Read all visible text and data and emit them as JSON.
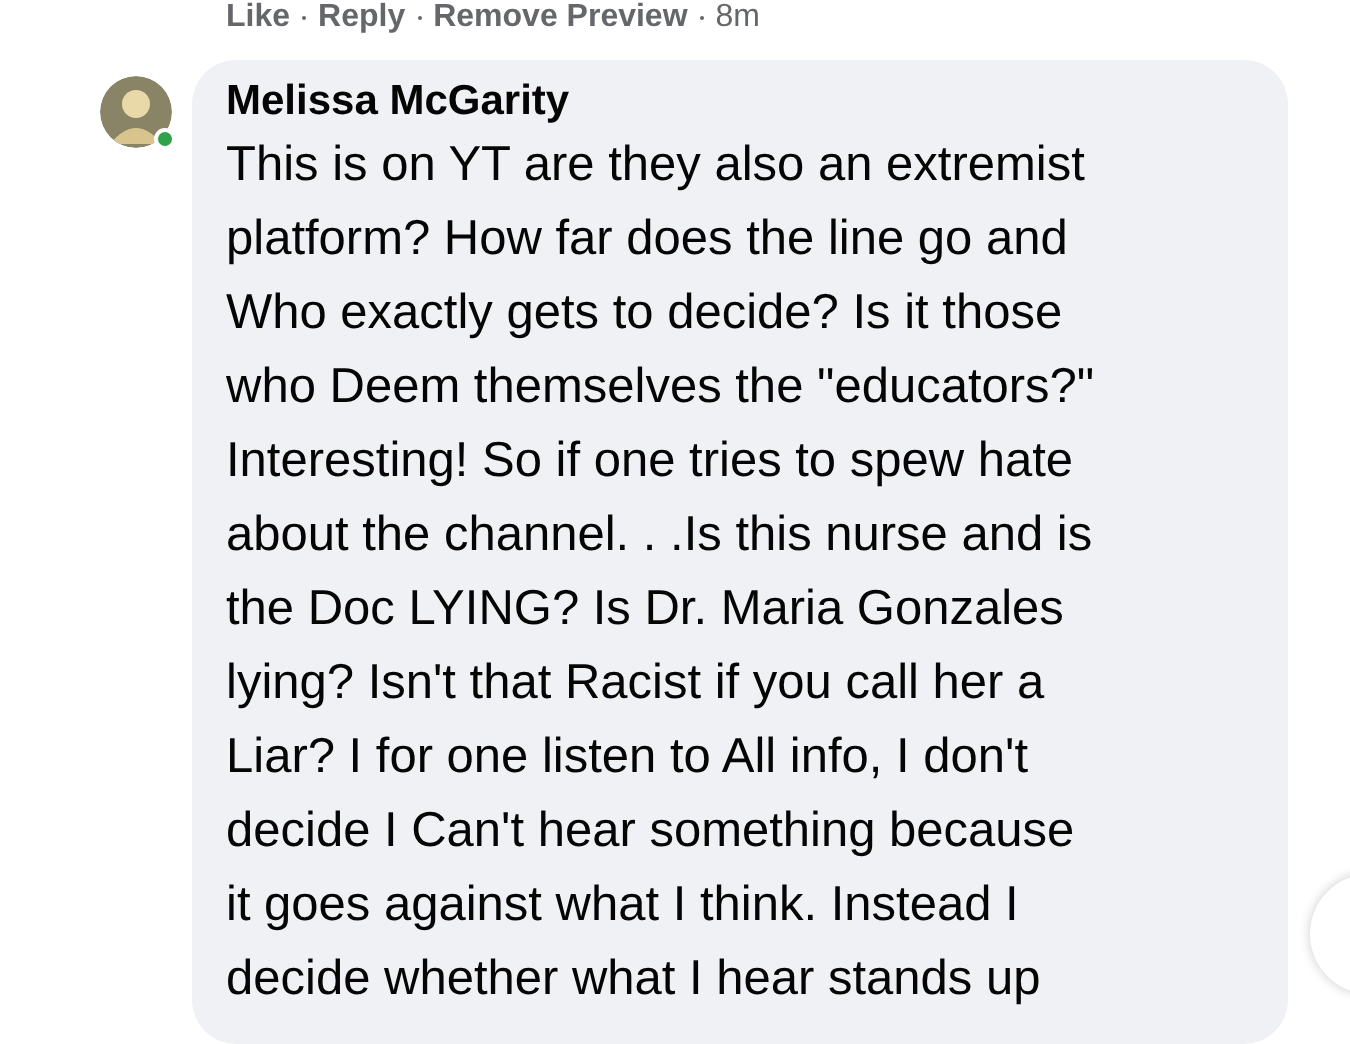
{
  "actions": [
    {
      "label": "Like"
    },
    {
      "label": "Reply"
    },
    {
      "label": "Remove Preview"
    }
  ],
  "time": "8m",
  "comment": {
    "author": "Melissa McGarity",
    "online": true,
    "lines": [
      "This is on YT are they also an extremist",
      "platform? How far does the line go and",
      "Who exactly gets to decide? Is it those",
      "who Deem themselves the \"educators?\"",
      "Interesting! So if one tries to spew hate",
      "about the channel. . .Is this nurse and is",
      "the Doc LYING? Is Dr. Maria Gonzales",
      "lying? Isn't that Racist if you call her a",
      "Liar? I for one listen to All info, I don't",
      "decide I Can't hear something because",
      "it goes against what I think. Instead I",
      "decide whether what I hear stands up"
    ]
  }
}
